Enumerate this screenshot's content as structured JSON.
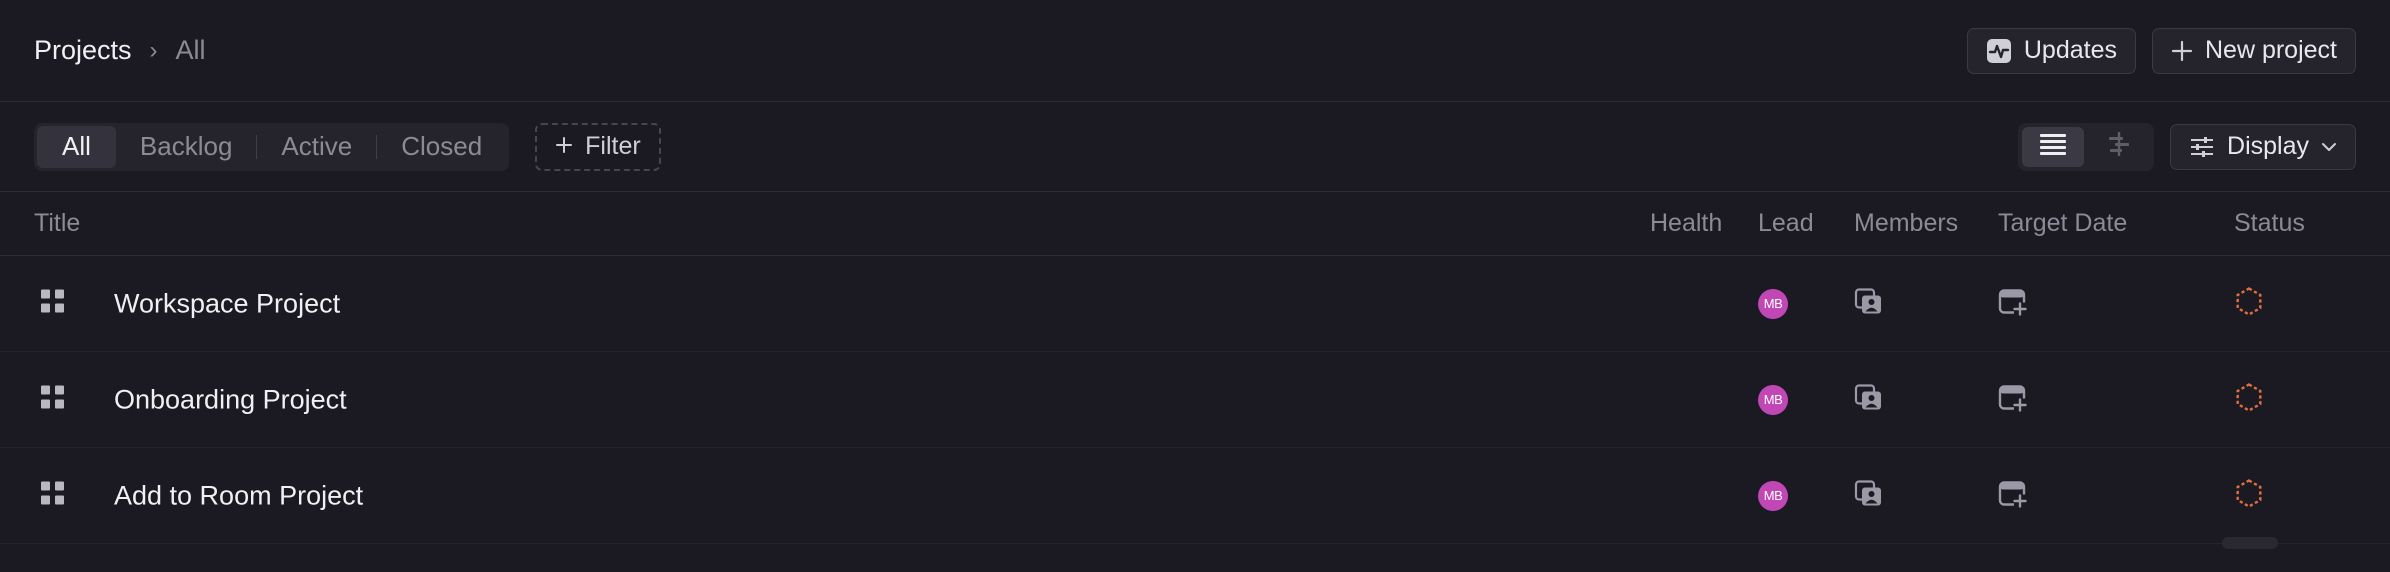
{
  "breadcrumb": {
    "root": "Projects",
    "separator": "›",
    "current": "All"
  },
  "header_actions": {
    "updates_label": "Updates",
    "new_project_label": "New project"
  },
  "filters": {
    "tabs": [
      {
        "label": "All",
        "active": true
      },
      {
        "label": "Backlog",
        "active": false
      },
      {
        "label": "Active",
        "active": false
      },
      {
        "label": "Closed",
        "active": false
      }
    ],
    "add_filter_label": "Filter"
  },
  "view": {
    "modes": [
      "list-view-icon",
      "timeline-view-icon"
    ],
    "active_mode": "list",
    "display_label": "Display"
  },
  "table": {
    "columns": {
      "title": "Title",
      "health": "Health",
      "lead": "Lead",
      "members": "Members",
      "target_date": "Target Date",
      "status": "Status"
    },
    "rows": [
      {
        "title": "Workspace Project",
        "lead_initials": "MB"
      },
      {
        "title": "Onboarding Project",
        "lead_initials": "MB"
      },
      {
        "title": "Add to Room Project",
        "lead_initials": "MB"
      }
    ]
  },
  "colors": {
    "background": "#1b1a22",
    "avatar": "#c247b6",
    "status_backlog": "#e0713d"
  }
}
